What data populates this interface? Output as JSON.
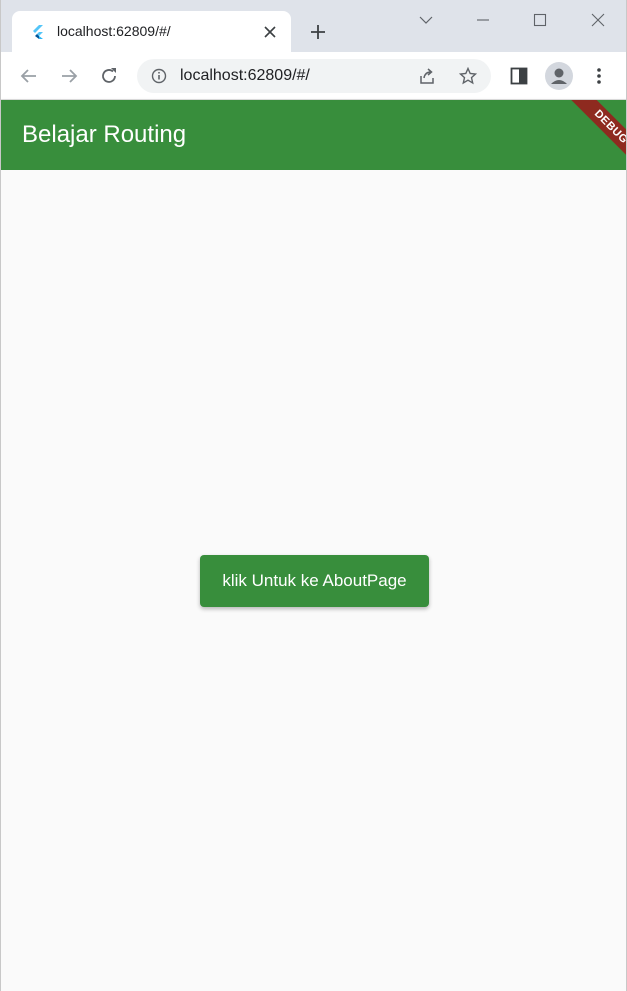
{
  "browser": {
    "tab": {
      "title": "localhost:62809/#/",
      "favicon": "flutter-icon"
    },
    "new_tab_icon": "plus-icon",
    "window_controls": [
      "tab-search-icon",
      "minimize-icon",
      "maximize-icon",
      "close-window-icon"
    ],
    "toolbar": {
      "back_icon": "arrow-left-icon",
      "forward_icon": "arrow-right-icon",
      "reload_icon": "reload-icon",
      "site_info_icon": "info-icon",
      "url": "localhost:62809/#/",
      "share_icon": "share-icon",
      "bookmark_icon": "star-icon",
      "side_panel_icon": "side-panel-icon",
      "profile_icon": "profile-icon",
      "menu_icon": "kebab-menu-icon"
    }
  },
  "app": {
    "title": "Belajar Routing",
    "debug_banner": "DEBUG",
    "button_label": "klik Untuk ke AboutPage",
    "colors": {
      "primary": "#388e3c",
      "background": "#fafafa",
      "debug_banner": "#8e2a1f"
    }
  }
}
